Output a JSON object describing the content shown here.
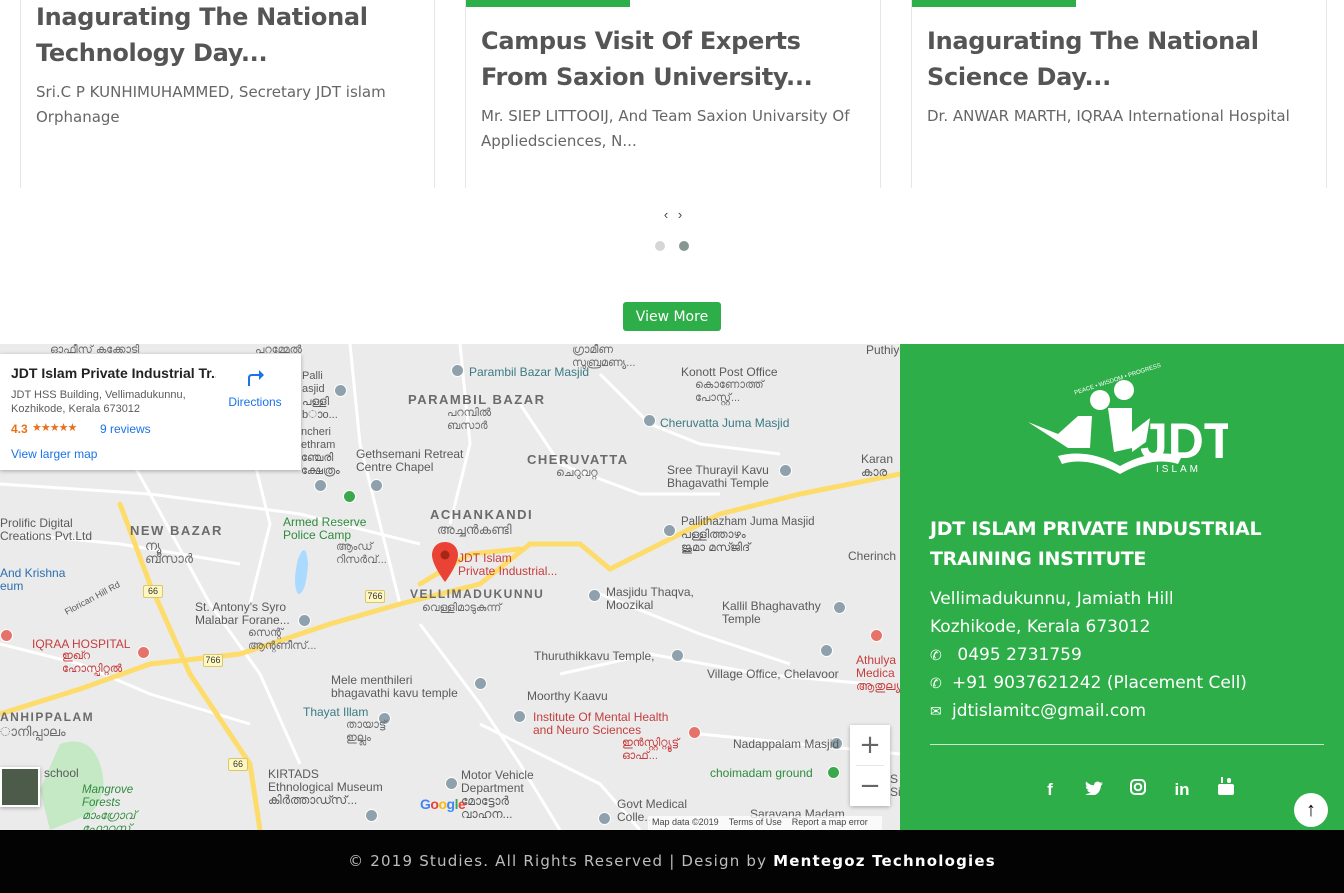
{
  "events": {
    "cards": [
      {
        "title": "Inagurating The National Technology Day...",
        "desc": "Sri.C P KUNHIMUHAMMED, Secretary JDT islam Orphanage"
      },
      {
        "title": "Campus Visit Of Experts From Saxion University...",
        "desc": "Mr. SIEP LITTOOIJ, And Team Saxion Univarsity Of Appliedsciences, N..."
      },
      {
        "title": "Inagurating The National Science Day...",
        "desc": "Dr. ANWAR MARTH, IQRAA International Hospital"
      }
    ],
    "prev": "‹",
    "next": "›",
    "view_more": "View More"
  },
  "map": {
    "info": {
      "title": "JDT Islam Private Industrial Tr...",
      "address": "JDT HSS Building, Vellimadukunnu, Kozhikode, Kerala 673012",
      "rating": "4.3",
      "stars": "★★★★★",
      "reviews": "9 reviews",
      "larger_map": "View larger map",
      "directions": "Directions"
    },
    "labels": {
      "parambil_bazar_masjid": "Parambil Bazar Masjid",
      "konott_post_office": "Konott Post Office",
      "konott_mal": "കൊണോത്ത്\nപോസ്റ്റ്...",
      "parambil_bazar": "PARAMBIL BAZAR",
      "parambil_bazar_mal": "പറമ്പിൽ\nബസാർ",
      "cheruvatta_juma_masjid": "Cheruvatta Juma Masjid",
      "gethsemani": "Gethsemani Retreat\nCentre Chapel",
      "cheruvatta": "CHERUVATTA",
      "cheruvatta_mal": "ചെറുവറ്റ",
      "sree_thurayil": "Sree Thurayil Kavu\nBhagavathi Temple",
      "karan": "Karan\nകാര",
      "achankandi": "ACHANKANDI",
      "achankandi_mal": "അച്ചൻകണ്ടി",
      "pallithazham": "Pallithazham Juma Masjid\nപള്ളിത്താഴം\nജുമാ മസ്ജിദ്",
      "armed_reserve": "Armed Reserve\nPolice Camp",
      "armed_reserve_mal": "ആംഡ്\nറിസർവ്...",
      "new_bazar": "NEW BAZAR",
      "new_bazar_mal": "ന്യൂ\nബസാർ",
      "prolific": "Prolific Digital\nCreations Pvt.Ltd",
      "and_krishna": "And Krishna\neum",
      "jdt_pin": "JDT Islam\nPrivate Industrial...",
      "vellimadukunnu": "VELLIMADUKUNNU",
      "vellimadukunnu_mal": "വെള്ളിമാടുകുന്ന്",
      "masjidu_thaqva": "Masjidu Thaqva,\nMoozikal",
      "kallil": "Kallil Bhaghavathy\nTemple",
      "cherinch": "Cherinch",
      "florican": "Florican Hill Rd",
      "st_antony": "St. Antony's Syro\nMalabar Forane...",
      "st_antony_mal": "സെന്റ്\nആന്റണീസ്...",
      "iqraa": "IQRAA HOSPITAL",
      "iqraa_mal": "ഇഖ്റ\nഹോസ്പിറ്റൽ",
      "thuruthikkavu": "Thuruthikkavu Temple,",
      "athulya": "Athulya\nMedica\nആതുല്യ",
      "mele_menthileri": "Mele menthileri\nbhagavathi kavu temple",
      "moorthy_kaavu": "Moorthy Kaavu",
      "village_office": "Village Office, Chelavoor",
      "anhippalam": "ANHIPPALAM",
      "anhippalam_mal": "ാനിപ്പാലം",
      "thayat_illam": "Thayat Illam",
      "thayat_mal": "തായാട്ട്\nഇല്ലം",
      "mental_health": "Institute Of Mental Health\nand Neuro Sciences",
      "mental_health_mal": "ഇൻസ്റ്റിറ്റ്യൂട്ട്\nഓഫ്...",
      "nadappalam": "Nadappalam Masjid",
      "school": "school",
      "mangrove": "Mangrove\nForests\nമാംഗ്രോവ്\nഫോറസ്റ്റ്",
      "kirtads": "KIRTADS\nEthnological Museum\nകിർത്താഡ്സ്...",
      "motor_vehicle": "Motor Vehicle\nDepartment\nമോട്ടോർ\nവാഹന...",
      "choimadam": "choimadam ground",
      "govt_medical": "Govt Medical\nColle...",
      "saravana": "Saravana Madam",
      "top_left": "ഓഫീസ് കക്കോടി",
      "top_mid": "ഗ്രാമീണ\nസുബ്രമണ്യ...",
      "top_right": "Puthiyoth",
      "top_mal2": "പറമ്മേൽ",
      "palli_left": "Palli\nasjid\nപള്ളി\nbാo...",
      "pancheri": "ncheri\nethram\nഞ്ചേരി\nക്ഷേത്രം",
      "road_66": "66",
      "road_766": "766",
      "s_edge": "S\nSi"
    },
    "zoom_in": "+",
    "zoom_out": "−",
    "google": "Google",
    "map_data": "Map data ©2019",
    "terms": "Terms of Use",
    "report": "Report a map error"
  },
  "contact": {
    "logo_text": "JDT",
    "logo_sub": "ISLAM",
    "logo_arc": "PEACE • WISDOM • PROGRESS",
    "institute": "JDT ISLAM PRIVATE INDUSTRIAL TRAINING INSTITUTE",
    "address1": "Vellimadukunnu, Jamiath Hill",
    "address2": "Kozhikode, Kerala 673012",
    "phone1": " 0495 2731759",
    "phone2": "+91 9037621242 (Placement Cell)",
    "email": "jdtislamitc@gmail.com",
    "social": [
      "f",
      "t",
      "ig",
      "in",
      "yt"
    ],
    "to_top": "↑"
  },
  "footer": {
    "copyright": "© 2019 Studies. All Rights Reserved | Design by ",
    "brand": "Mentegoz Technologies"
  },
  "colors": {
    "green": "#2eae48",
    "footer_bg": "#030303",
    "map_bg": "#ebebeb"
  }
}
